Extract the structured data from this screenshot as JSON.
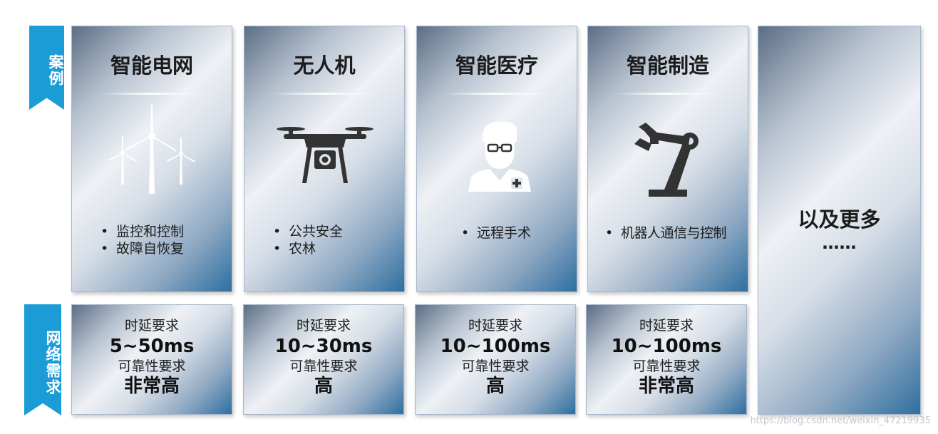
{
  "labels": {
    "cases": "案例",
    "network_requirements": "网络需求"
  },
  "cases": [
    {
      "title": "智能电网",
      "icon": "wind-turbine-icon",
      "bullets": [
        "监控和控制",
        "故障自恢复"
      ]
    },
    {
      "title": "无人机",
      "icon": "drone-icon",
      "bullets": [
        "公共安全",
        "农林"
      ]
    },
    {
      "title": "智能医疗",
      "icon": "doctor-icon",
      "bullets": [
        "远程手术"
      ]
    },
    {
      "title": "智能制造",
      "icon": "robot-arm-icon",
      "bullets": [
        "机器人通信与控制"
      ]
    }
  ],
  "more": {
    "title": "以及更多",
    "ellipsis": "……"
  },
  "requirements": [
    {
      "latency_label": "时延要求",
      "latency": "5~50ms",
      "reliability_label": "可靠性要求",
      "reliability": "非常高"
    },
    {
      "latency_label": "时延要求",
      "latency": "10~30ms",
      "reliability_label": "可靠性要求",
      "reliability": "高"
    },
    {
      "latency_label": "时延要求",
      "latency": "10~100ms",
      "reliability_label": "可靠性要求",
      "reliability": "高"
    },
    {
      "latency_label": "时延要求",
      "latency": "10~100ms",
      "reliability_label": "可靠性要求",
      "reliability": "非常高"
    }
  ],
  "watermark": "https://blog.csdn.net/weixin_47219935",
  "colors": {
    "accent": "#1b9cd6",
    "icon_dark": "#333333",
    "icon_light": "#ffffff"
  }
}
